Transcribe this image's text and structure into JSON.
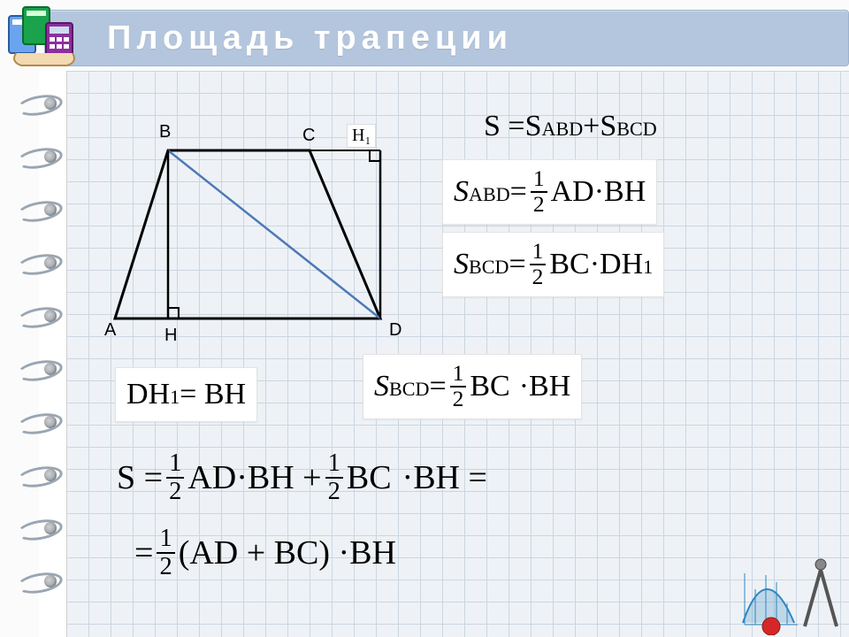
{
  "title": "Площадь трапеции",
  "diagram": {
    "vertices": {
      "A": "A",
      "B": "B",
      "C": "C",
      "D": "D",
      "H": "H",
      "H1": "H₁"
    }
  },
  "formulas": {
    "f1_prefix": "S =",
    "f1_s_abd": "S",
    "f1_abd_sub": "ABD",
    "f1_plus": " + ",
    "f1_s_bcd": "S",
    "f1_bcd_sub": "BCD",
    "f2_left_s": "S",
    "f2_left_sub": "ABD",
    "f2_eq": " = ",
    "f2_rhs": " AD·BH",
    "f3_left_s": "S",
    "f3_left_sub": "BCD",
    "f3_eq": " = ",
    "f3_mid": " BC·D",
    "f3_h": "H",
    "f3_h_sub": "1",
    "f4_lhs_d": "D",
    "f4_lhs_h": "H",
    "f4_lhs_hsub": "1",
    "f4_eq": "= BH",
    "f5_left_s": "S",
    "f5_left_sub": "BCD",
    "f5_eq": " = ",
    "f5_mid": " BC",
    "f5_tail": " ·BH",
    "f6a": "S = ",
    "f6b": " AD·BH + ",
    "f6c": " BC",
    "f6d": " ·BH =",
    "f7a": "= ",
    "f7b": " (AD + BC) ·BH",
    "half_num": "1",
    "half_den": "2"
  },
  "icons": {
    "books": "books-calculator-icon",
    "corner": "graph-compass-icon"
  }
}
